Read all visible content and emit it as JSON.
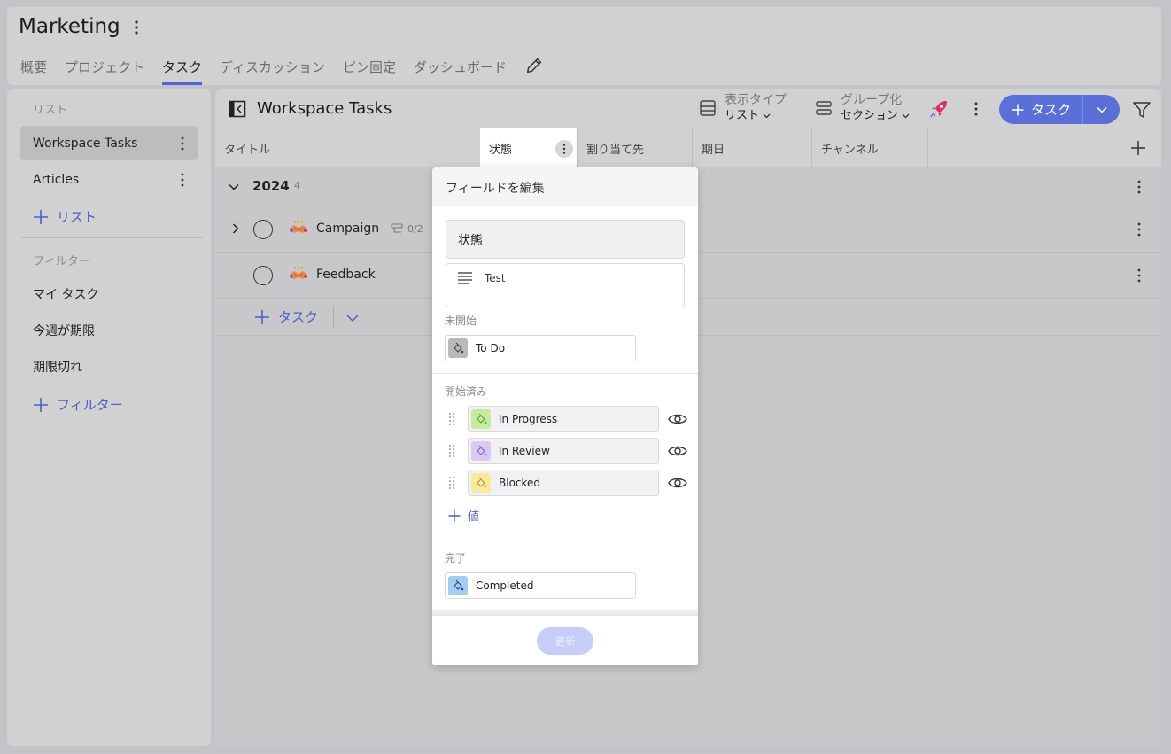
{
  "workspace": {
    "title": "Marketing"
  },
  "tabs": [
    {
      "label": "概要",
      "active": false
    },
    {
      "label": "プロジェクト",
      "active": false
    },
    {
      "label": "タスク",
      "active": true
    },
    {
      "label": "ディスカッション",
      "active": false
    },
    {
      "label": "ピン固定",
      "active": false
    },
    {
      "label": "ダッシュボード",
      "active": false
    }
  ],
  "sidebar": {
    "lists_label": "リスト",
    "lists": [
      {
        "label": "Workspace Tasks",
        "selected": true
      },
      {
        "label": "Articles",
        "selected": false
      }
    ],
    "add_list_label": "リスト",
    "filters_label": "フィルター",
    "filters": [
      "マイ タスク",
      "今週が期限",
      "期限切れ"
    ],
    "add_filter_label": "フィルター"
  },
  "toolbar": {
    "title": "Workspace Tasks",
    "view_type": {
      "label": "表示タイプ",
      "value": "リスト"
    },
    "grouping": {
      "label": "グループ化",
      "value": "セクション"
    },
    "add_task_label": "タスク"
  },
  "columns": [
    {
      "label": "タイトル"
    },
    {
      "label": "状態"
    },
    {
      "label": "割り当て先"
    },
    {
      "label": "期日"
    },
    {
      "label": "チャンネル"
    }
  ],
  "group": {
    "title": "2024",
    "count": "4"
  },
  "tasks": [
    {
      "name": "Campaign",
      "subtasks": "0/2",
      "has_children": true
    },
    {
      "name": "Feedback",
      "subtasks": "",
      "has_children": false
    }
  ],
  "add_task_row_label": "タスク",
  "popup": {
    "title": "フィールドを編集",
    "field_name": "状態",
    "field_description": "Test",
    "sections": {
      "not_started": {
        "label": "未開始",
        "items": [
          {
            "label": "To Do",
            "color": "#b9b9b9"
          }
        ]
      },
      "started": {
        "label": "開始済み",
        "items": [
          {
            "label": "In Progress",
            "color": "#c7eb9e"
          },
          {
            "label": "In Review",
            "color": "#d9c9f3"
          },
          {
            "label": "Blocked",
            "color": "#f7ea9b"
          }
        ],
        "add_value_label": "値"
      },
      "done": {
        "label": "完了",
        "items": [
          {
            "label": "Completed",
            "color": "#a4cdf2"
          }
        ]
      }
    },
    "update_label": "更新"
  },
  "colors": {
    "accent": "#5b6fd8",
    "link": "#4d5fc9"
  }
}
